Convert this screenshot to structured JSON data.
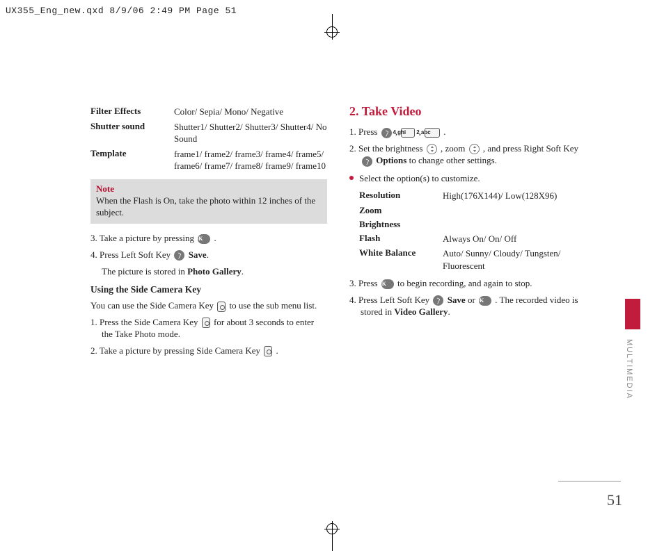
{
  "slug": "UX355_Eng_new.qxd  8/9/06  2:49 PM  Page 51",
  "left": {
    "settings": [
      {
        "label": "Filter Effects",
        "value": "Color/ Sepia/ Mono/ Negative"
      },
      {
        "label": "Shutter sound",
        "value": "Shutter1/ Shutter2/ Shutter3/ Shutter4/ No Sound"
      },
      {
        "label": "Template",
        "value": "frame1/ frame2/ frame3/ frame4/ frame5/ frame6/ frame7/ frame8/ frame9/ frame10"
      }
    ],
    "note_head": "Note",
    "note_body": "When the Flash is On, take the photo within 12 inches of the subject.",
    "step3_a": "3. Take a picture by pressing ",
    "step3_b": ".",
    "step4_a": "4. Press Left Soft Key ",
    "step4_b": " Save",
    "step4_c": ".",
    "step4_sub_a": "The picture is stored in ",
    "step4_sub_b": "Photo Gallery",
    "step4_sub_c": ".",
    "using_head": "Using the Side Camera Key",
    "using_a": "You can use the Side Camera Key ",
    "using_b": " to use the sub menu list.",
    "sck1_a": "1. Press the Side Camera Key ",
    "sck1_b": " for about 3 seconds to enter the Take Photo mode.",
    "sck2_a": "2. Take a picture by pressing Side Camera Key ",
    "sck2_b": "."
  },
  "right": {
    "head": "2. Take Video",
    "s1_a": "1. Press ",
    "s1_b": ", ",
    "s1_c": ", ",
    "s1_d": ".",
    "key4": "4 ghi",
    "key2": "2 abc",
    "s2_a": "2. Set the brightness ",
    "s2_b": ", zoom ",
    "s2_c": ", and press Right Soft Key ",
    "s2_d": " Options",
    "s2_e": " to change other settings.",
    "bullet": "Select the option(s) to customize.",
    "settings": [
      {
        "label": "Resolution",
        "value": "High(176X144)/ Low(128X96)"
      },
      {
        "label": "Zoom",
        "value": ""
      },
      {
        "label": "Brightness",
        "value": ""
      },
      {
        "label": "Flash",
        "value": "Always On/ On/ Off"
      },
      {
        "label": "White Balance",
        "value": "Auto/ Sunny/ Cloudy/ Tungsten/ Fluorescent"
      }
    ],
    "s3_a": "3. Press ",
    "s3_b": " to begin recording, and again to stop.",
    "s4_a": "4. Press Left Soft Key ",
    "s4_b": " Save",
    "s4_c": " or ",
    "s4_d": ". The recorded video is stored in ",
    "s4_e": "Video Gallery",
    "s4_f": "."
  },
  "ok_label": "OK",
  "section_tab": "MULTIMEDIA",
  "page_number": "51"
}
